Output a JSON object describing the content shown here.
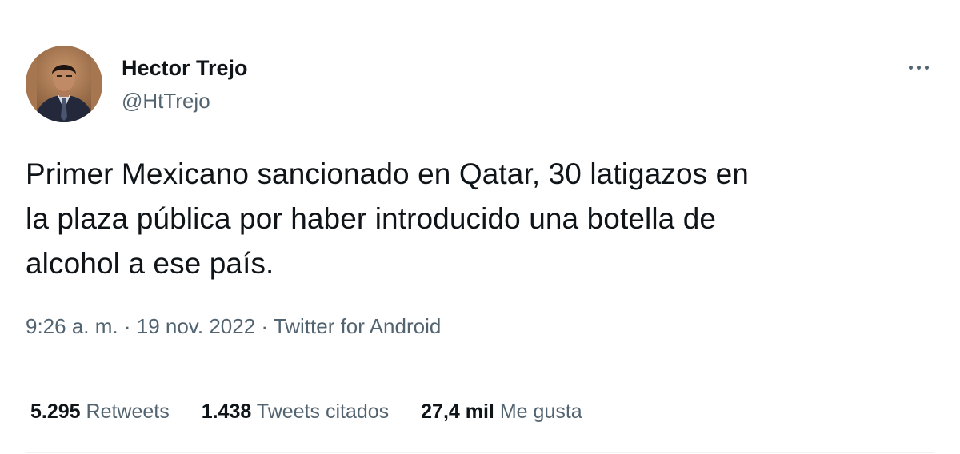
{
  "author": {
    "name": "Hector Trejo",
    "handle": "@HtTrejo"
  },
  "tweet": {
    "text_lines": [
      "Primer Mexicano sancionado en Qatar, 30 latigazos en",
      "la plaza pública por haber introducido una botella de",
      "alcohol a ese país."
    ],
    "time": "9:26 a. m.",
    "date": "19 nov. 2022",
    "source": "Twitter for Android",
    "separator": " · "
  },
  "stats": {
    "retweets": {
      "count": "5.295",
      "label": "Retweets"
    },
    "quotes": {
      "count": "1.438",
      "label": "Tweets citados"
    },
    "likes": {
      "count": "27,4 mil",
      "label": "Me gusta"
    }
  },
  "icons": {
    "more": "more-horizontal-icon"
  },
  "colors": {
    "primary_text": "#0f1419",
    "secondary_text": "#536471",
    "divider": "#eff3f4"
  }
}
